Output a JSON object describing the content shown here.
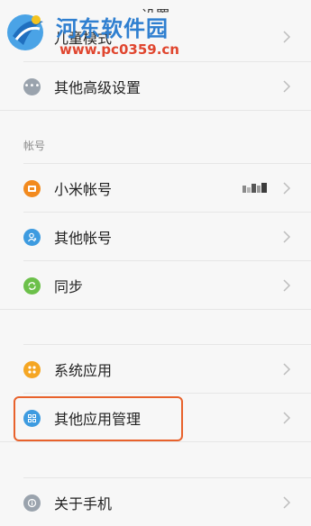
{
  "topbar": {
    "title": "设置"
  },
  "watermark": {
    "title": "河东软件园",
    "url": "www.pc0359.cn"
  },
  "rows_top": [
    {
      "label": "儿童模式",
      "icon": "child-mode-icon",
      "color": "#9aa3ad"
    },
    {
      "label": "其他高级设置",
      "icon": "more-settings-icon",
      "color": "#9aa3ad"
    }
  ],
  "section_account": {
    "header": "帐号"
  },
  "rows_account": [
    {
      "label": "小米帐号",
      "icon": "mi-account-icon",
      "color": "#f28a1e"
    },
    {
      "label": "其他帐号",
      "icon": "other-account-icon",
      "color": "#3d9be0"
    },
    {
      "label": "同步",
      "icon": "sync-icon",
      "color": "#6cc04a"
    }
  ],
  "rows_apps": [
    {
      "label": "系统应用",
      "icon": "system-apps-icon",
      "color": "#f5a623"
    },
    {
      "label": "其他应用管理",
      "icon": "app-management-icon",
      "color": "#3d9be0"
    }
  ],
  "rows_bottom": [
    {
      "label": "关于手机",
      "icon": "about-phone-icon",
      "color": "#9aa3ad"
    }
  ],
  "colors": {
    "highlight": "#e8622c",
    "background": "#f7f7f7",
    "divider": "#e6e6e6"
  }
}
